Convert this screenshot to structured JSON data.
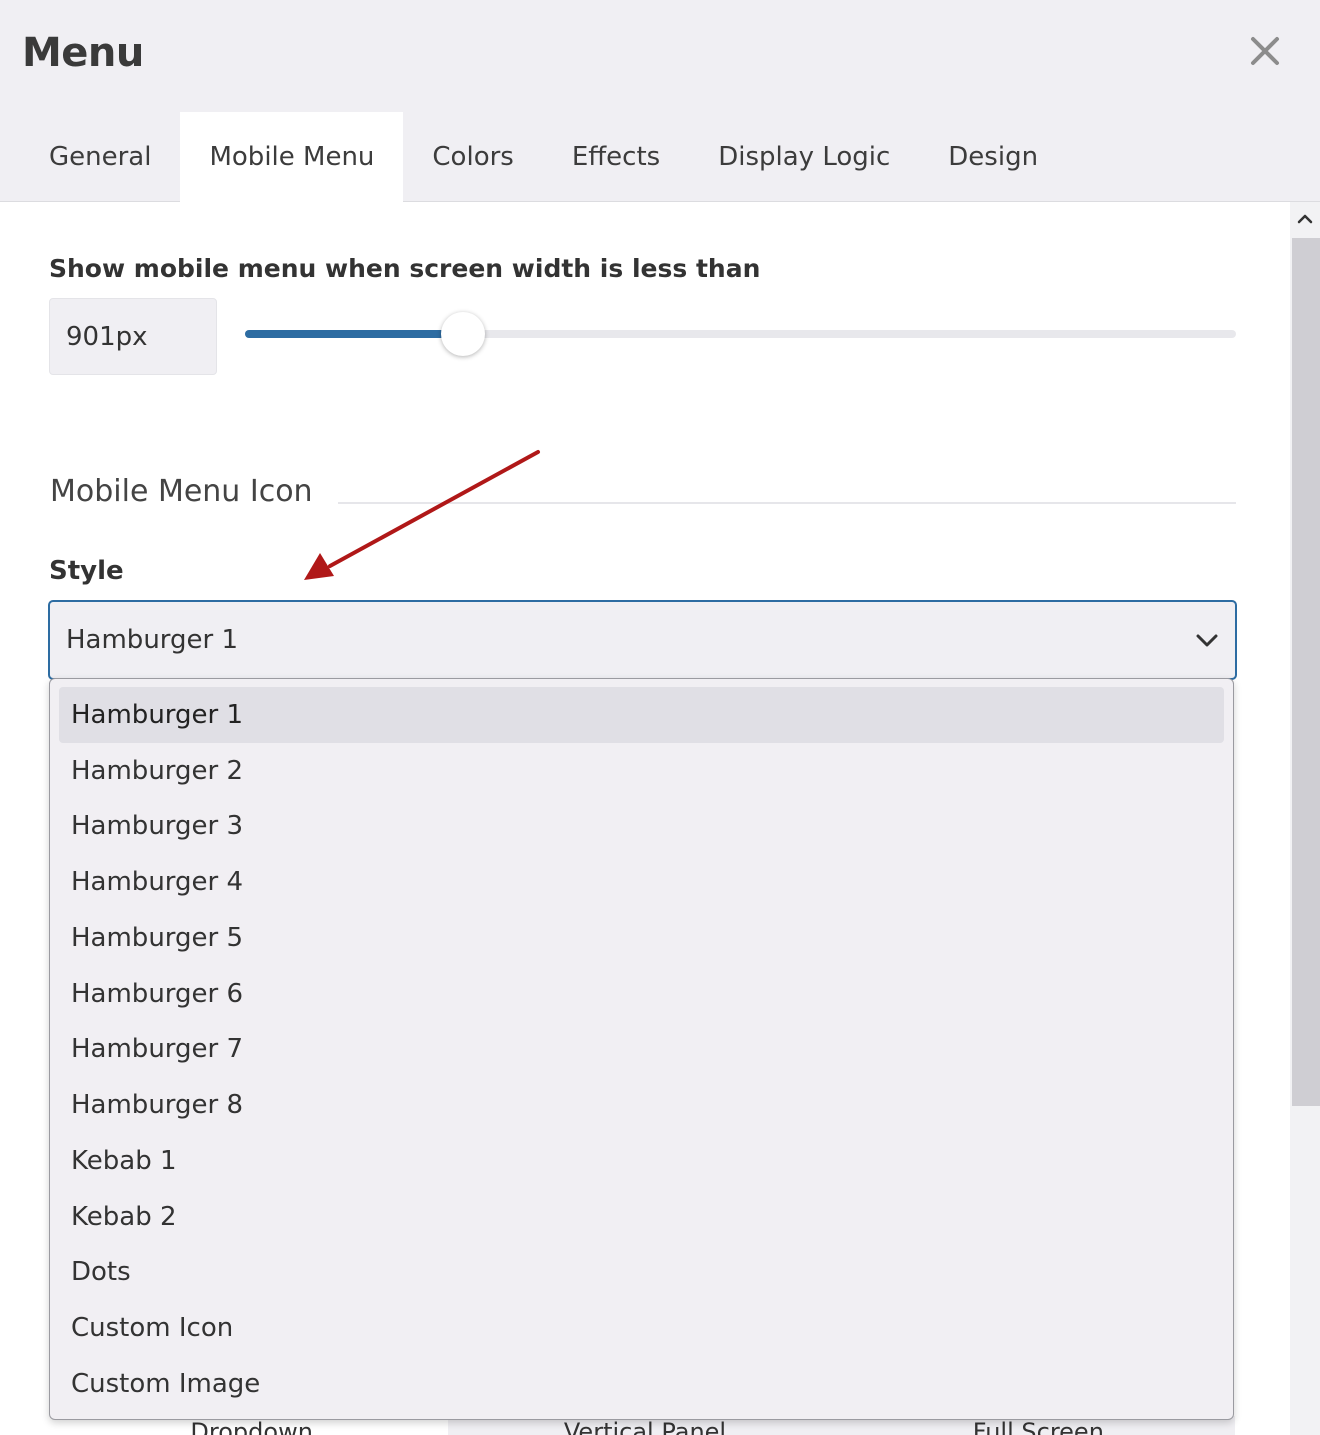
{
  "dialog": {
    "title": "Menu"
  },
  "tabs": [
    {
      "label": "General"
    },
    {
      "label": "Mobile Menu",
      "active": true
    },
    {
      "label": "Colors"
    },
    {
      "label": "Effects"
    },
    {
      "label": "Display Logic"
    },
    {
      "label": "Design"
    }
  ],
  "breakpoint": {
    "label": "Show mobile menu when screen width is less than",
    "value": "901px",
    "slider_fraction": 0.22
  },
  "mobile_menu_icon": {
    "section_title": "Mobile Menu Icon",
    "style_label": "Style",
    "selected": "Hamburger 1",
    "options": [
      "Hamburger 1",
      "Hamburger 2",
      "Hamburger 3",
      "Hamburger 4",
      "Hamburger 5",
      "Hamburger 6",
      "Hamburger 7",
      "Hamburger 8",
      "Kebab 1",
      "Kebab 2",
      "Dots",
      "Custom Icon",
      "Custom Image"
    ]
  },
  "menu_type_options": [
    "Dropdown",
    "Vertical Panel",
    "Full Screen"
  ],
  "colors": {
    "accent": "#2d6ca2",
    "annotation_arrow": "#b01818"
  },
  "icons": {
    "close": "close-icon",
    "chevron": "chevron-down-icon",
    "scroll_up": "chevron-up-icon"
  }
}
